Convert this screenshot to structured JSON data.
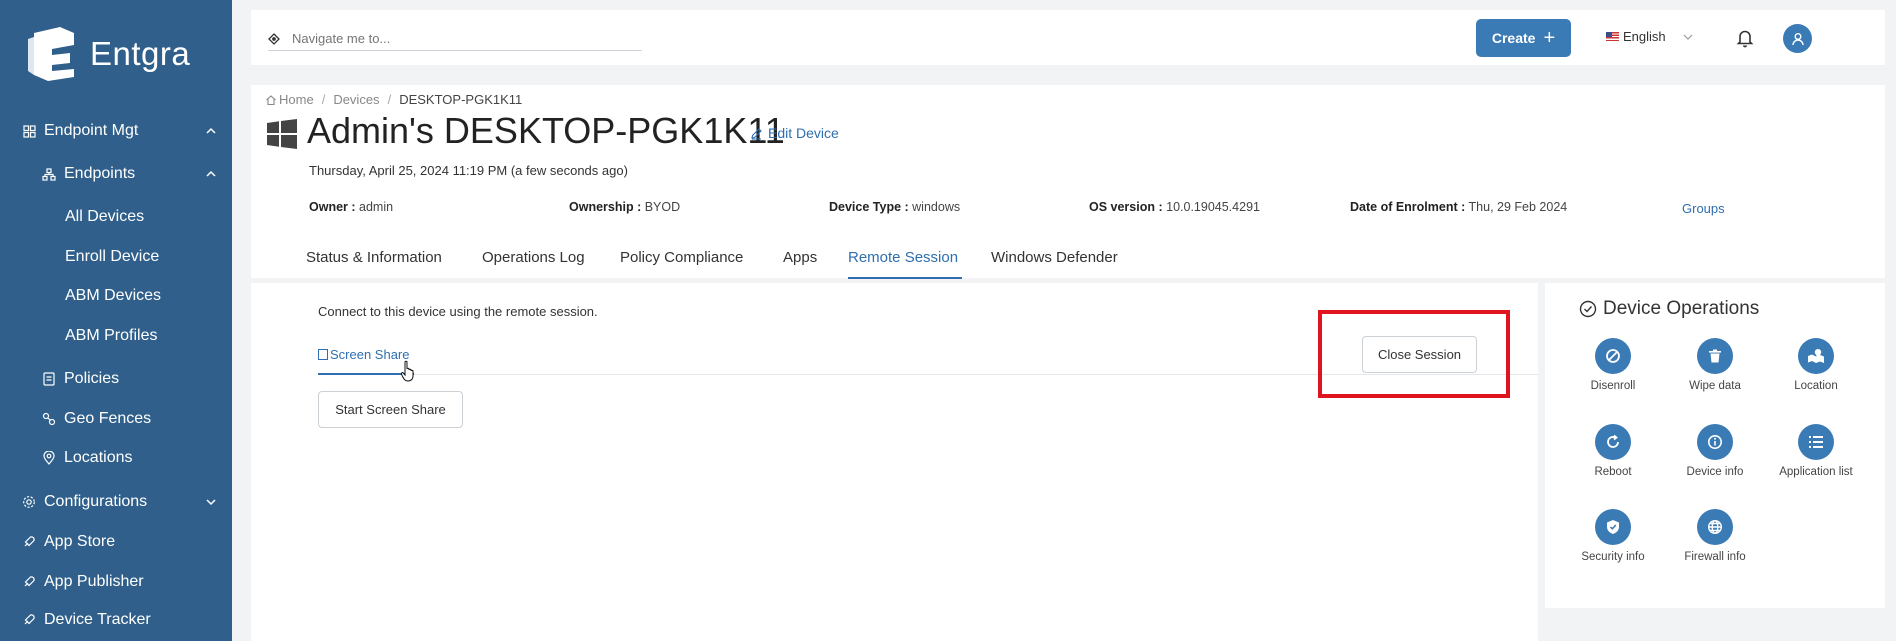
{
  "app": {
    "name": "Entgra"
  },
  "sidebar": {
    "items": [
      {
        "label": "Endpoint Mgt"
      },
      {
        "label": "Endpoints"
      },
      {
        "label": "All Devices"
      },
      {
        "label": "Enroll Device"
      },
      {
        "label": "ABM Devices"
      },
      {
        "label": "ABM Profiles"
      },
      {
        "label": "Policies"
      },
      {
        "label": "Geo Fences"
      },
      {
        "label": "Locations"
      },
      {
        "label": "Configurations"
      },
      {
        "label": "App Store"
      },
      {
        "label": "App Publisher"
      },
      {
        "label": "Device Tracker"
      }
    ]
  },
  "topbar": {
    "search_placeholder": "Navigate me to...",
    "create_label": "Create",
    "create_plus": "+",
    "language": "English"
  },
  "breadcrumb": {
    "home": "Home",
    "devices": "Devices",
    "current": "DESKTOP-PGK1K11",
    "sep": "/"
  },
  "device": {
    "title": "Admin's DESKTOP-PGK1K11",
    "edit_label": "Edit Device",
    "timestamp": "Thursday, April 25, 2024 11:19 PM (a few seconds ago)",
    "owner_label": "Owner :",
    "owner_value": "admin",
    "ownership_label": "Ownership :",
    "ownership_value": "BYOD",
    "device_type_label": "Device Type :",
    "device_type_value": "windows",
    "os_label": "OS version :",
    "os_value": "10.0.19045.4291",
    "enrol_label": "Date of Enrolment :",
    "enrol_value": "Thu, 29 Feb 2024",
    "groups_label": "Groups"
  },
  "tabs": [
    {
      "label": "Status & Information"
    },
    {
      "label": "Operations Log"
    },
    {
      "label": "Policy Compliance"
    },
    {
      "label": "Apps"
    },
    {
      "label": "Remote Session"
    },
    {
      "label": "Windows Defender"
    }
  ],
  "remote": {
    "connect_text": "Connect to this device using the remote session.",
    "screen_share_tab": "Screen Share",
    "close_session": "Close Session",
    "start_screen_share": "Start Screen Share"
  },
  "operations": {
    "title": "Device Operations",
    "items": [
      {
        "label": "Disenroll",
        "icon": "disenroll-icon"
      },
      {
        "label": "Wipe data",
        "icon": "trash-icon"
      },
      {
        "label": "Location",
        "icon": "location-icon"
      },
      {
        "label": "Reboot",
        "icon": "reboot-icon"
      },
      {
        "label": "Device info",
        "icon": "info-icon"
      },
      {
        "label": "Application list",
        "icon": "list-icon"
      },
      {
        "label": "Security info",
        "icon": "shield-icon"
      },
      {
        "label": "Firewall info",
        "icon": "globe-icon"
      }
    ]
  },
  "colors": {
    "sidebar": "#2f5f8a",
    "accent": "#3a7ab5",
    "link": "#2f6fb0",
    "highlight": "#e0141e"
  }
}
